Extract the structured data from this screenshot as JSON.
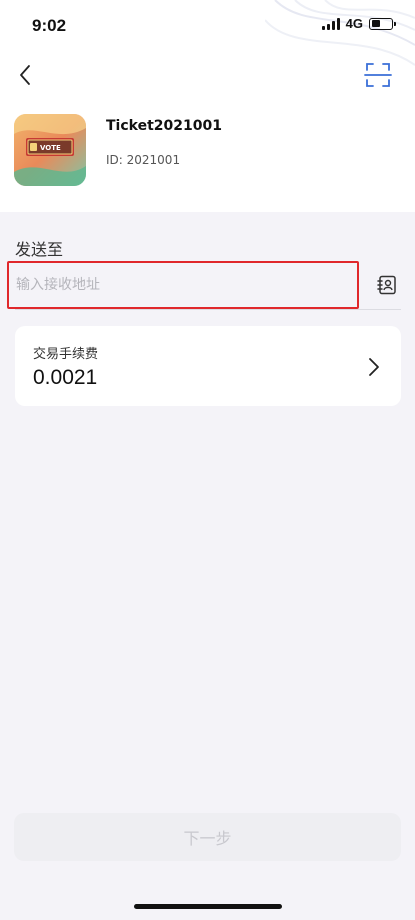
{
  "status_bar": {
    "time": "9:02",
    "network": "4G",
    "battery_level": 0.45
  },
  "token": {
    "name": "Ticket2021001",
    "id_text": "ID: 2021001",
    "thumb_text": "VOTE"
  },
  "send_to": {
    "label": "发送至",
    "placeholder": "输入接收地址",
    "value": ""
  },
  "fee": {
    "title": "交易手续费",
    "value": "0.0021"
  },
  "next_button": {
    "label": "下一步"
  },
  "colors": {
    "highlight_border": "#e0282c",
    "scan_icon": "#3a6fd8",
    "page_bg": "#f4f3f8"
  }
}
